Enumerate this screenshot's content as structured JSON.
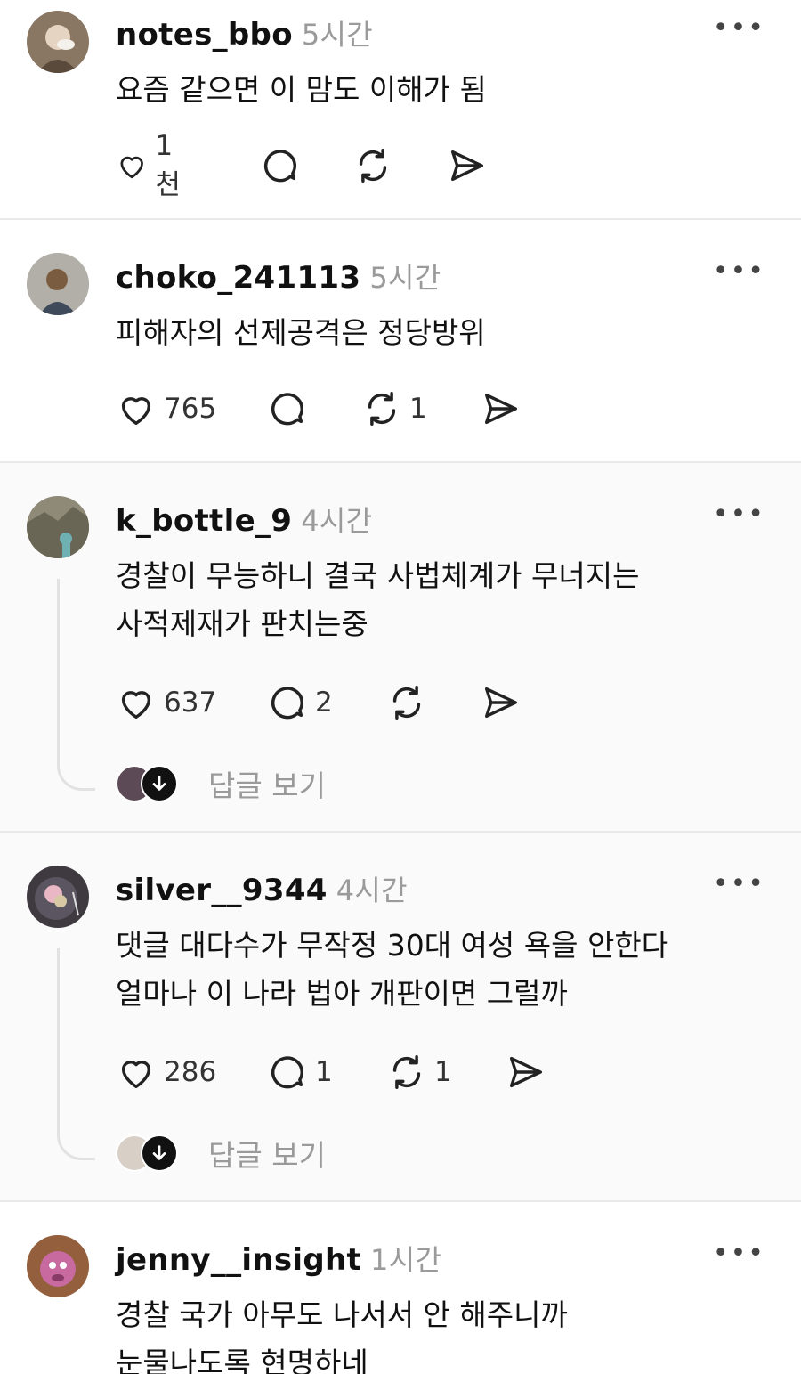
{
  "posts": [
    {
      "username": "notes_bbo",
      "time": "5시간",
      "more": "•••",
      "text": "요즘 같으면 이 맘도 이해가 됨",
      "likes": "1천",
      "comments": "",
      "reposts": "",
      "avatar_color": "#8a7763"
    },
    {
      "username": "choko_241113",
      "time": "5시간",
      "more": "•••",
      "text": "피해자의 선제공격은 정당방위",
      "likes": "765",
      "comments": "",
      "reposts": "1",
      "avatar_color": "#6d6a5f"
    },
    {
      "username": "k_bottle_9",
      "time": "4시간",
      "more": "•••",
      "text": "경찰이 무능하니 결국 사법체계가 무너지는\n사적제재가 판치는중",
      "likes": "637",
      "comments": "2",
      "reposts": "",
      "view_replies": "답글 보기",
      "avatar_color": "#7d7a6c"
    },
    {
      "username": "silver__9344",
      "time": "4시간",
      "more": "•••",
      "text": "댓글 대다수가 무작정 30대 여성 욕을 안한다\n얼마나 이 나라 법아 개판이면 그럴까",
      "likes": "286",
      "comments": "1",
      "reposts": "1",
      "view_replies": "답글 보기",
      "avatar_color": "#3e3a3f"
    },
    {
      "username": "jenny__insight",
      "time": "1시간",
      "more": "•••",
      "text": "경찰 국가 아무도 나서서 안 해주니까\n눈물나도록 현명하네",
      "avatar_color": "#9a5a88"
    }
  ]
}
